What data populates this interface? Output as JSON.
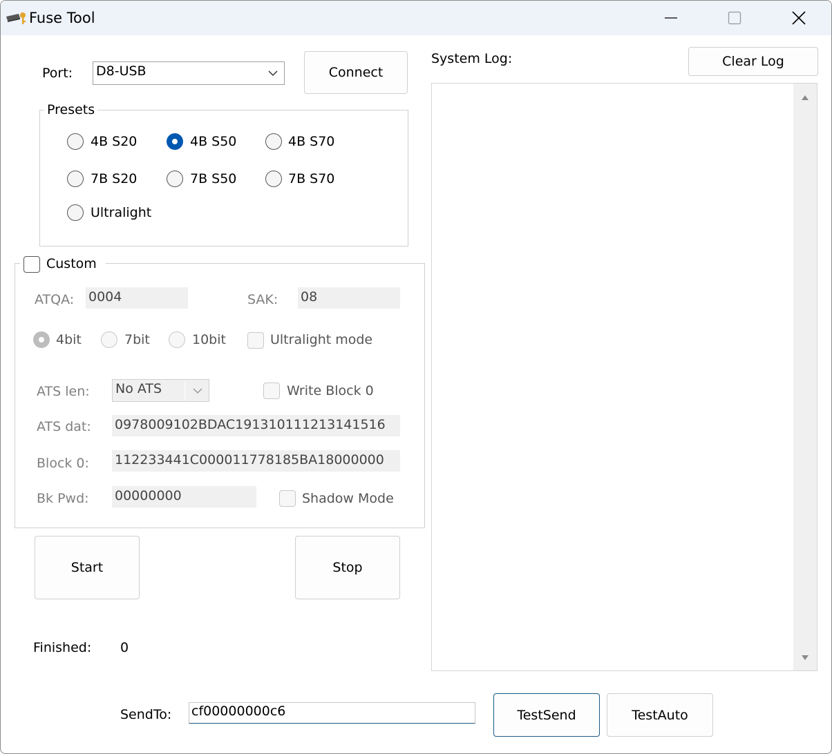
{
  "window": {
    "title": "Fuse Tool"
  },
  "port": {
    "label": "Port:",
    "selected": "D8-USB",
    "connect_label": "Connect"
  },
  "presets": {
    "title": "Presets",
    "options": [
      "4B S20",
      "4B S50",
      "4B S70",
      "7B S20",
      "7B S50",
      "7B S70",
      "Ultralight"
    ],
    "selected": "4B S50"
  },
  "custom": {
    "label": "Custom",
    "checked": false,
    "atqa_label": "ATQA:",
    "atqa_value": "0004",
    "sak_label": "SAK:",
    "sak_value": "08",
    "bit_options": [
      "4bit",
      "7bit",
      "10bit"
    ],
    "bit_selected": "4bit",
    "ultralight_label": "Ultralight mode",
    "ats_len_label": "ATS len:",
    "ats_len_value": "No ATS",
    "write_block0_label": "Write Block 0",
    "ats_dat_label": "ATS dat:",
    "ats_dat_value": "0978009102BDAC191310111213141516",
    "block0_label": "Block 0:",
    "block0_value": "112233441C000011778185BA18000000",
    "bk_pwd_label": "Bk Pwd:",
    "bk_pwd_value": "00000000",
    "shadow_label": "Shadow Mode"
  },
  "actions": {
    "start_label": "Start",
    "stop_label": "Stop"
  },
  "finished": {
    "label": "Finished:",
    "value": "0"
  },
  "log": {
    "label": "System Log:",
    "clear_label": "Clear Log"
  },
  "send": {
    "label": "SendTo:",
    "value": "cf00000000c6",
    "test_send_label": "TestSend",
    "test_auto_label": "TestAuto"
  },
  "colors": {
    "accent": "#0058b0",
    "titlebar": "#eef2f9",
    "disabled_text": "#808080"
  }
}
